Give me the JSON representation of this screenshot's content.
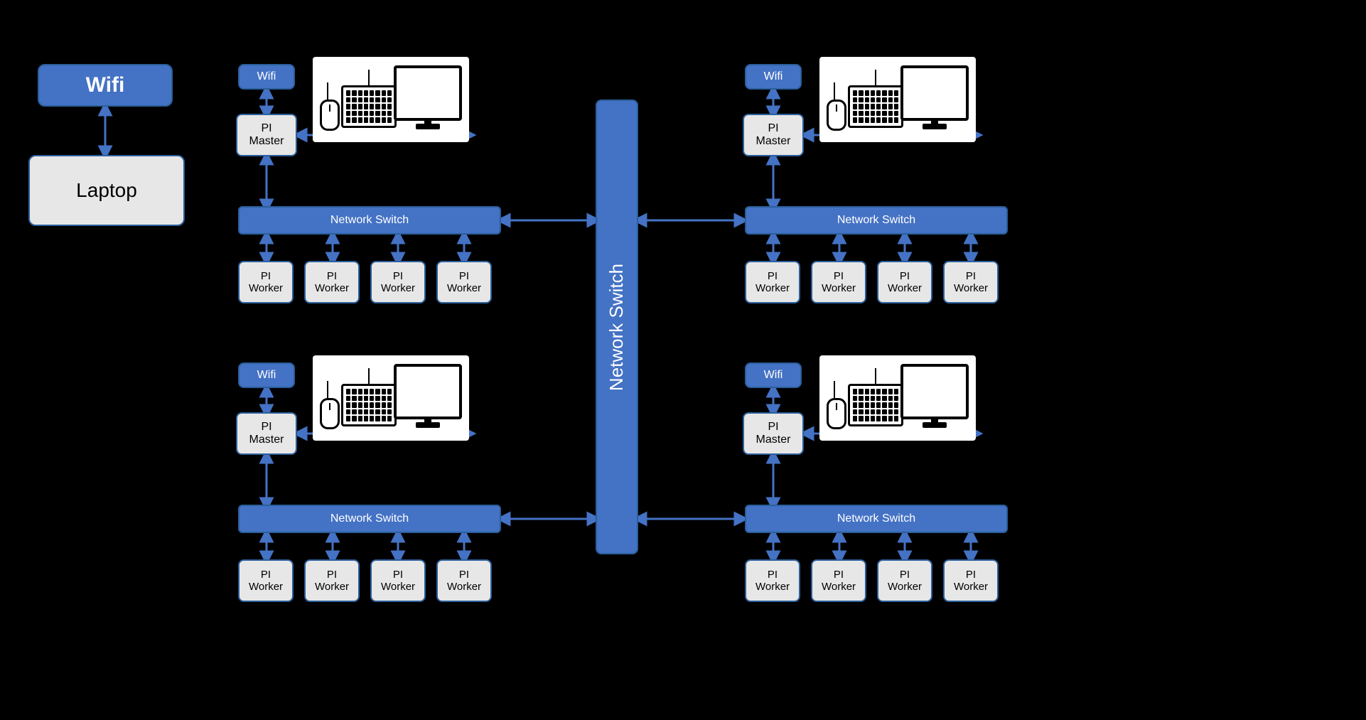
{
  "colors": {
    "blue": "#4472c4",
    "blueBorder": "#2b5f9c",
    "grey": "#e7e7e7"
  },
  "left": {
    "wifi_label": "Wifi",
    "laptop_label": "Laptop"
  },
  "center_switch_label": "Network Switch",
  "cluster_labels": {
    "wifi": "Wifi",
    "master_line1": "PI",
    "master_line2": "Master",
    "switch": "Network Switch",
    "worker_line1": "PI",
    "worker_line2": "Worker"
  },
  "clusters": [
    {
      "id": "cluster-top-left"
    },
    {
      "id": "cluster-top-right"
    },
    {
      "id": "cluster-bottom-left"
    },
    {
      "id": "cluster-bottom-right"
    }
  ]
}
